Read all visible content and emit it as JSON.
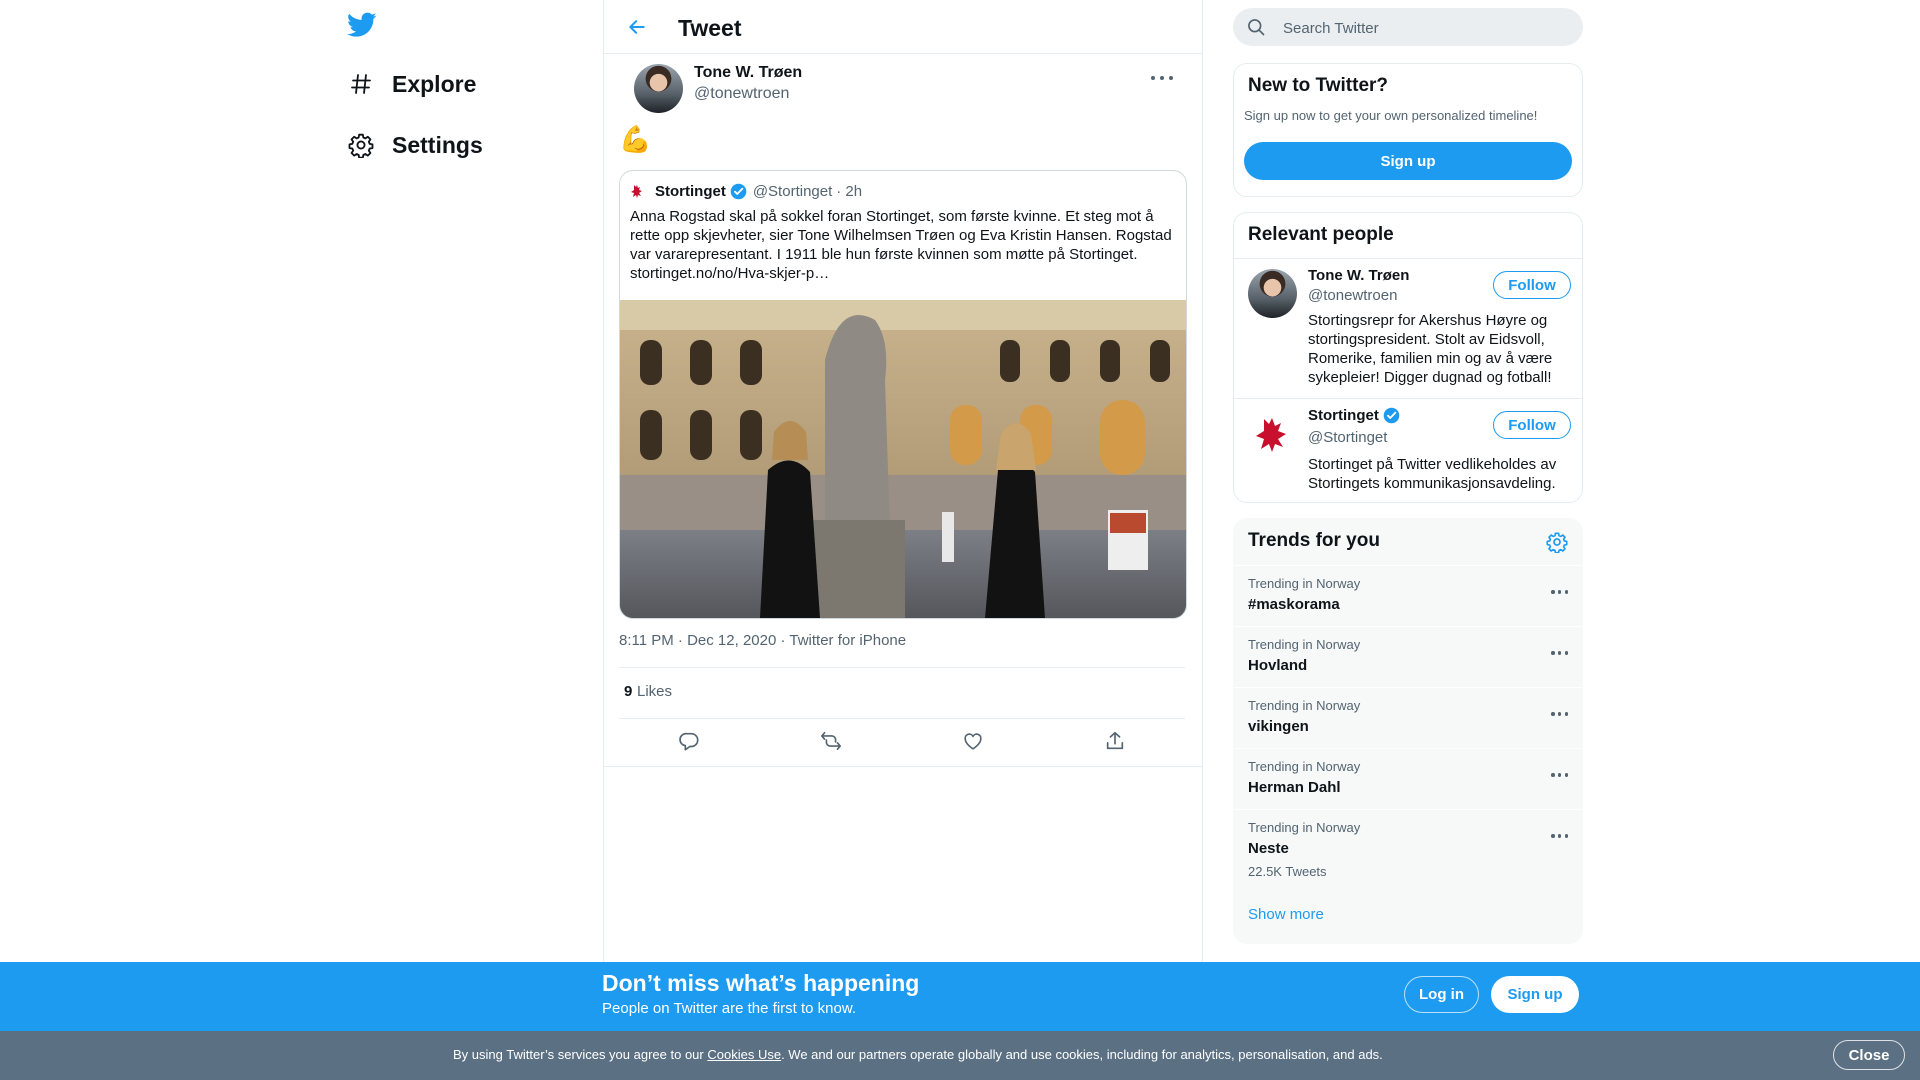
{
  "colors": {
    "accent": "#1d9bf0",
    "text": "#0f1419",
    "secondary": "#536471",
    "cookie_bar": "#5b7083"
  },
  "nav": {
    "logo_icon": "twitter-bird-icon",
    "items": [
      {
        "label": "Explore",
        "icon": "hashtag-icon"
      },
      {
        "label": "Settings",
        "icon": "gear-icon"
      }
    ]
  },
  "header": {
    "title": "Tweet",
    "back_icon": "arrow-left-icon"
  },
  "tweet": {
    "author": {
      "name": "Tone W. Trøen",
      "handle": "@tonewtroen"
    },
    "text": "💪",
    "quoted": {
      "name": "Stortinget",
      "handle": "@Stortinget",
      "time": "· 2h",
      "text": "Anna Rogstad skal på sokkel foran Stortinget, som første kvinne. Et steg mot å rette opp skjevheter, sier Tone Wilhelmsen Trøen og Eva Kristin Hansen. Rogstad var vararepresentant. I 1911 ble hun første kvinnen som møtte på Stortinget. stortinget.no/no/Hva-skjer-p…"
    },
    "timestamp": "8:11 PM · Dec 12, 2020",
    "separator": " · ",
    "source": "Twitter for iPhone",
    "likes_count": "9",
    "likes_label": "Likes",
    "actions": [
      "reply-icon",
      "retweet-icon",
      "like-icon",
      "share-icon"
    ]
  },
  "search": {
    "placeholder": "Search Twitter"
  },
  "new_to_twitter": {
    "title": "New to Twitter?",
    "subtitle": "Sign up now to get your own personalized timeline!",
    "button": "Sign up"
  },
  "relevant_people": {
    "title": "Relevant people",
    "people": [
      {
        "name": "Tone W. Trøen",
        "handle": "@tonewtroen",
        "bio": "Stortingsrepr for Akershus Høyre og stortingspresident. Stolt av Eidsvoll, Romerike, familien min og av å være sykepleier! Digger dugnad og fotball!",
        "button": "Follow"
      },
      {
        "name": "Stortinget",
        "handle": "@Stortinget",
        "bio": "Stortinget på Twitter vedlikeholdes av Stortingets kommunikasjonsavdeling.",
        "button": "Follow"
      }
    ]
  },
  "trends": {
    "title": "Trends for you",
    "items": [
      {
        "context": "Trending in Norway",
        "name": "#maskorama"
      },
      {
        "context": "Trending in Norway",
        "name": "Hovland"
      },
      {
        "context": "Trending in Norway",
        "name": "vikingen"
      },
      {
        "context": "Trending in Norway",
        "name": "Herman Dahl"
      },
      {
        "context": "Trending in Norway",
        "name": "Neste",
        "count": "22.5K Tweets"
      }
    ],
    "show_more": "Show more"
  },
  "banner": {
    "title": "Don’t miss what’s happening",
    "subtitle": "People on Twitter are the first to know.",
    "login": "Log in",
    "signup": "Sign up"
  },
  "cookie": {
    "text_before": "By using Twitter’s services you agree to our ",
    "link": "Cookies Use",
    "text_after": ". We and our partners operate globally and use cookies, including for analytics, personalisation, and ads.",
    "close": "Close"
  }
}
